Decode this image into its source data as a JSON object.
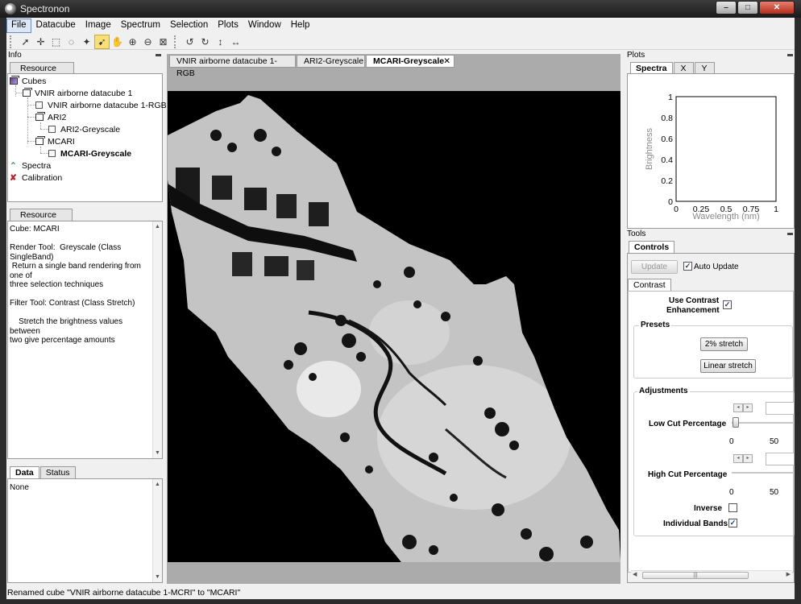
{
  "window": {
    "title": "Spectronon",
    "buttons": [
      "–",
      "□",
      "✕"
    ]
  },
  "menu": [
    "File",
    "Datacube",
    "Image",
    "Spectrum",
    "Selection",
    "Plots",
    "Window",
    "Help"
  ],
  "toolbar": {
    "tools": [
      "arrow-select-icon",
      "crosshair-icon",
      "rect-select-icon",
      "lasso-icon",
      "magic-wand-icon",
      "pointer-pick-icon",
      "hand-pan-icon",
      "zoom-in-icon",
      "zoom-out-icon",
      "zoom-fit-icon"
    ],
    "transforms": [
      "rotate-left-icon",
      "rotate-right-icon",
      "flip-vertical-icon",
      "flip-horizontal-icon"
    ]
  },
  "info_dock": {
    "title": "Info",
    "tree_tab": "Resource Tree",
    "tree": [
      {
        "label": "Cubes",
        "level": 0,
        "icon": "cube-filled"
      },
      {
        "label": "VNIR airborne datacube 1",
        "level": 1,
        "icon": "cube"
      },
      {
        "label": "VNIR airborne datacube 1-RGB",
        "level": 2,
        "icon": "square"
      },
      {
        "label": "ARI2",
        "level": 2,
        "icon": "cube"
      },
      {
        "label": "ARI2-Greyscale",
        "level": 3,
        "icon": "square"
      },
      {
        "label": "MCARI",
        "level": 2,
        "icon": "cube"
      },
      {
        "label": "MCARI-Greyscale",
        "level": 3,
        "icon": "square",
        "bold": true
      },
      {
        "label": "Spectra",
        "level": 0,
        "icon": "spectra"
      },
      {
        "label": "Calibration",
        "level": 0,
        "icon": "calibration"
      }
    ],
    "resource_info_tab": "Resource Info",
    "resource_info_text": "Cube: MCARI\n\nRender Tool:  Greyscale (Class SingleBand)\n Return a single band rendering from one of\nthree selection techniques\n\nFilter Tool: Contrast (Class Stretch)\n\n    Stretch the brightness values between\ntwo give percentage amounts",
    "data_tabs": [
      "Data",
      "Status"
    ],
    "data_text": "None"
  },
  "documents": {
    "tabs": [
      "VNIR airborne datacube 1-RGB",
      "ARI2-Greyscale",
      "MCARI-Greyscale"
    ],
    "active": 2
  },
  "plots_dock": {
    "title": "Plots",
    "tabs": [
      "Spectra",
      "X",
      "Y"
    ],
    "chart": {
      "xlabel": "Wavelength (nm)",
      "ylabel": "Brightness",
      "xticks": [
        "0",
        "0.25",
        "0.5",
        "0.75",
        "1"
      ],
      "yticks": [
        "0",
        "0.2",
        "0.4",
        "0.6",
        "0.8",
        "1"
      ]
    }
  },
  "tools_dock": {
    "title": "Tools",
    "tab": "Controls",
    "update_button": "Update",
    "auto_update_label": "Auto Update",
    "contrast_tab": "Contrast",
    "use_contrast_label_1": "Use Contrast",
    "use_contrast_label_2": "Enhancement",
    "presets_title": "Presets",
    "preset_2pct": "2% stretch",
    "preset_linear": "Linear stretch",
    "adjustments_title": "Adjustments",
    "low_cut_label": "Low Cut Percentage",
    "high_cut_label": "High Cut Percentage",
    "slider_min": "0",
    "slider_max": "50",
    "low_cut_value": 0,
    "inverse_label": "Inverse",
    "individual_bands_label": "Individual Bands",
    "scroll_thumb": "|||"
  },
  "status": "Renamed cube \"VNIR airborne datacube 1-MCRI\" to \"MCARI\""
}
